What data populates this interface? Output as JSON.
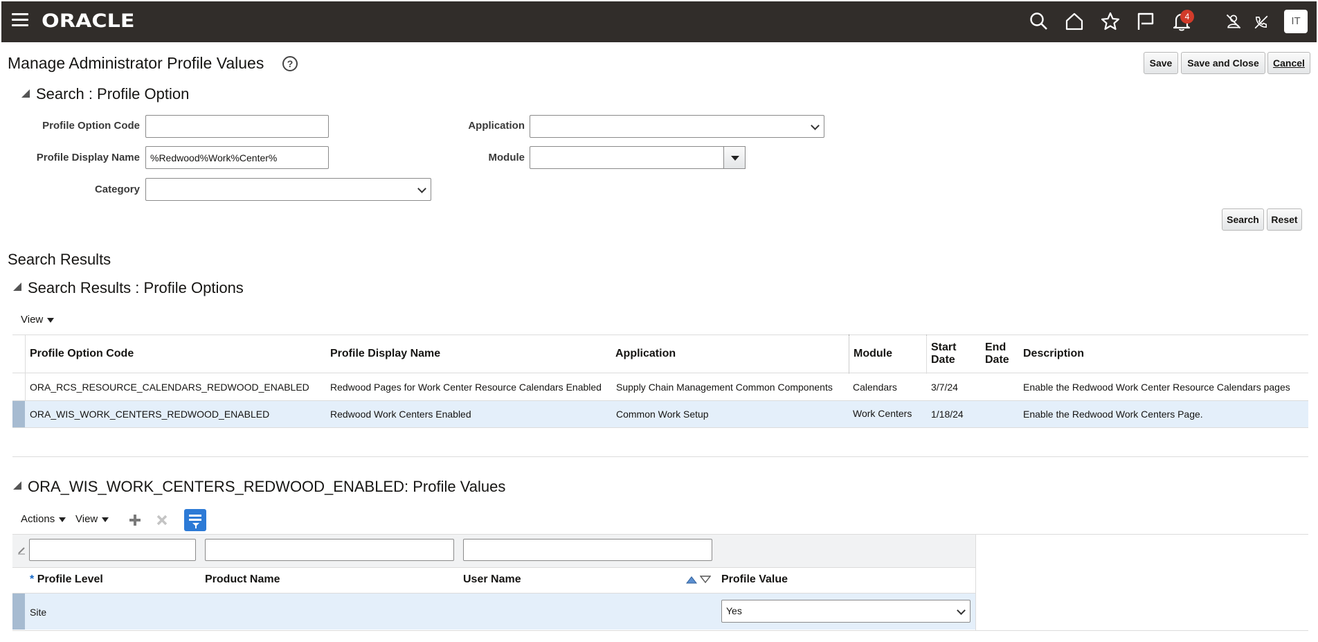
{
  "topbar": {
    "brand": "ORACLE",
    "notification_count": "4",
    "user_initials": "IT",
    "icons": [
      "menu-icon",
      "search-icon",
      "home-icon",
      "star-icon",
      "flag-icon",
      "bell-icon",
      "user-off-icon",
      "phone-off-icon"
    ]
  },
  "page": {
    "title": "Manage Administrator Profile Values",
    "help_icon": "?",
    "save_label": "Save",
    "save_close_label": "Save and Close",
    "cancel_label": "Cancel"
  },
  "search": {
    "section_title": "Search : Profile Option",
    "profile_option_code_label": "Profile Option Code",
    "profile_option_code_value": "",
    "profile_display_name_label": "Profile Display Name",
    "profile_display_name_value": "%Redwood%Work%Center%",
    "category_label": "Category",
    "category_value": "",
    "application_label": "Application",
    "application_value": "",
    "module_label": "Module",
    "module_value": "",
    "search_label": "Search",
    "reset_label": "Reset"
  },
  "results": {
    "heading": "Search Results",
    "section_title": "Search Results : Profile Options",
    "view_label": "View",
    "columns": {
      "code": "Profile Option Code",
      "display_name": "Profile Display Name",
      "application": "Application",
      "module": "Module",
      "start_date_1": "Start",
      "start_date_2": "Date",
      "end_date_1": "End",
      "end_date_2": "Date",
      "description": "Description"
    },
    "rows": [
      {
        "code": "ORA_RCS_RESOURCE_CALENDARS_REDWOOD_ENABLED",
        "display_name": "Redwood Pages for Work Center Resource Calendars Enabled",
        "application": "Supply Chain Management Common Components",
        "module": "Calendars",
        "start_date": "3/7/24",
        "end_date": "",
        "description": "Enable the Redwood Work Center Resource Calendars pages"
      },
      {
        "code": "ORA_WIS_WORK_CENTERS_REDWOOD_ENABLED",
        "display_name": "Redwood Work Centers Enabled",
        "application": "Common Work Setup",
        "module": "Work Centers",
        "start_date": "1/18/24",
        "end_date": "",
        "description": "Enable the Redwood Work Centers Page."
      }
    ]
  },
  "values": {
    "section_title": "ORA_WIS_WORK_CENTERS_REDWOOD_ENABLED: Profile Values",
    "actions_label": "Actions",
    "view_label": "View",
    "columns": {
      "required_mark": "*",
      "profile_level": "Profile Level",
      "product_name": "Product Name",
      "user_name": "User Name",
      "profile_value": "Profile Value"
    },
    "rows": [
      {
        "profile_level": "Site",
        "product_name": "",
        "user_name": "",
        "profile_value": "Yes"
      }
    ]
  },
  "colors": {
    "topbar": "#312d2a",
    "selected_row": "#e4effa",
    "filter_button": "#2c7ad6",
    "badge": "#d23b2a"
  }
}
